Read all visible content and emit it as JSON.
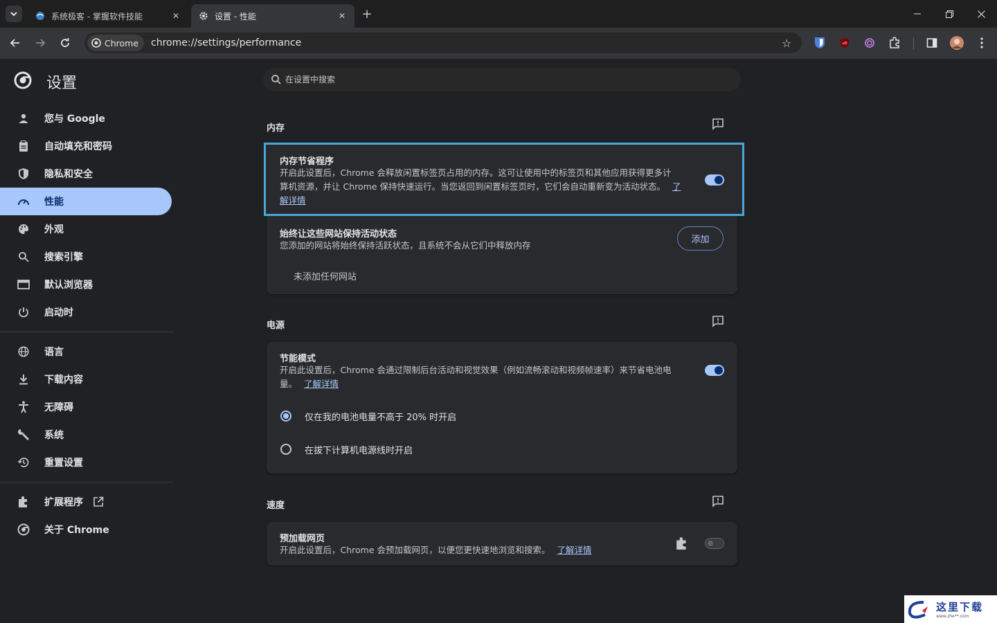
{
  "tabs": [
    {
      "title": "系统极客 - 掌握软件技能",
      "favicon": "globe-icon"
    },
    {
      "title": "设置 - 性能",
      "favicon": "gear-icon"
    }
  ],
  "toolbar": {
    "chip_label": "Chrome",
    "url": "chrome://settings/performance"
  },
  "sidebar": {
    "title": "设置",
    "items": [
      {
        "label": "您与 Google",
        "icon": "person-icon"
      },
      {
        "label": "自动填充和密码",
        "icon": "clipboard-icon"
      },
      {
        "label": "隐私和安全",
        "icon": "shield-icon"
      },
      {
        "label": "性能",
        "icon": "speedometer-icon"
      },
      {
        "label": "外观",
        "icon": "palette-icon"
      },
      {
        "label": "搜索引擎",
        "icon": "search-icon"
      },
      {
        "label": "默认浏览器",
        "icon": "browser-icon"
      },
      {
        "label": "启动时",
        "icon": "power-icon"
      },
      {
        "label": "语言",
        "icon": "globe-icon"
      },
      {
        "label": "下载内容",
        "icon": "download-icon"
      },
      {
        "label": "无障碍",
        "icon": "accessibility-icon"
      },
      {
        "label": "系统",
        "icon": "wrench-icon"
      },
      {
        "label": "重置设置",
        "icon": "history-icon"
      },
      {
        "label": "扩展程序",
        "icon": "puzzle-icon"
      },
      {
        "label": "关于 Chrome",
        "icon": "chrome-icon"
      }
    ]
  },
  "search": {
    "placeholder": "在设置中搜索"
  },
  "memory": {
    "section_title": "内存",
    "saver_title": "内存节省程序",
    "saver_desc_1": "开启此设置后，Chrome 会释放闲置标签页占用的内存。这可让使用中的标签页和其他应用获得更多计",
    "saver_desc_2": "算机资源，并让 Chrome 保持快速运行。当您返回到闲置标签页时，它们会自动重新变为活动状态。",
    "link_part1": "了",
    "link_part2": "解详情",
    "saver_enabled": true,
    "keep_title": "始终让这些网站保持活动状态",
    "keep_desc": "您添加的网站将始终保持活跃状态，且系统不会从它们中释放内存",
    "add_label": "添加",
    "empty_label": "未添加任何网站"
  },
  "power": {
    "section_title": "电源",
    "saver_title": "节能模式",
    "saver_desc_1": "开启此设置后，Chrome 会通过限制后台活动和视觉效果（例如流畅滚动和视频帧速率）来节省电池电",
    "saver_desc_2": "量。",
    "link": "了解详情",
    "saver_enabled": true,
    "option_1": "仅在我的电池电量不高于 20% 时开启",
    "option_2": "在拔下计算机电源线时开启",
    "selected_option": 1
  },
  "speed": {
    "section_title": "速度",
    "preload_title": "预加载网页",
    "preload_desc": "开启此设置后，Chrome 会预加载网页，以便您更快速地浏览和搜索。",
    "link": "了解详情",
    "preload_enabled": false
  },
  "watermark": {
    "text": "这里下载",
    "url_text": "www.zhe**.com"
  },
  "colors": {
    "accent": "#a8c7fa",
    "highlight_border": "#4aa8d8",
    "background": "#202124",
    "card": "#292a2d"
  }
}
